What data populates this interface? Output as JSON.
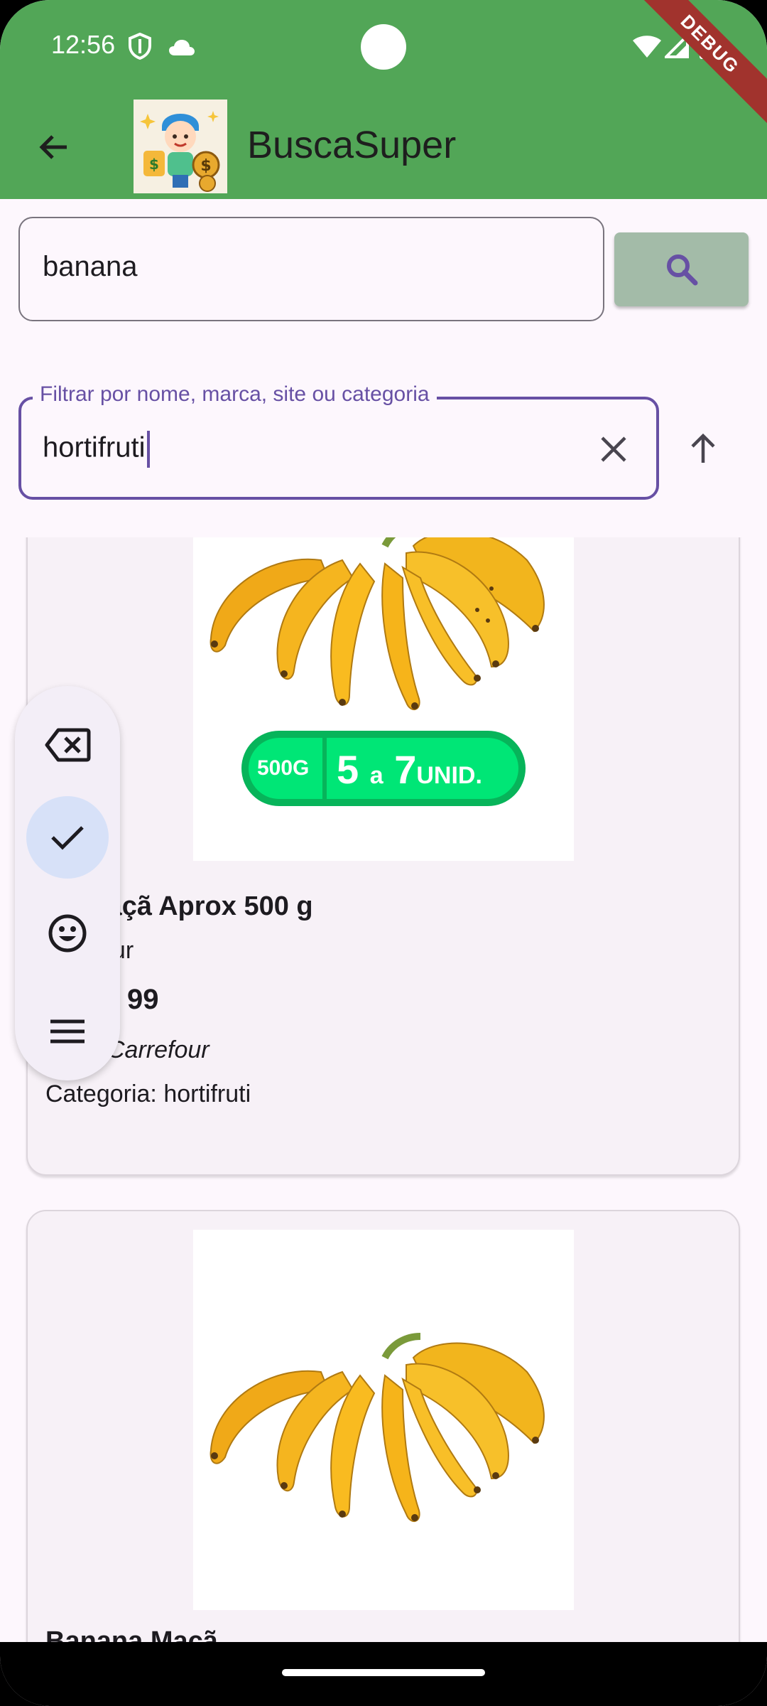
{
  "status_bar": {
    "time": "12:56"
  },
  "debug_banner": "DEBUG",
  "app_bar": {
    "title": "BuscaSuper"
  },
  "search": {
    "value": "banana"
  },
  "filter": {
    "label": "Filtrar por nome, marca, site ou categoria",
    "value": "hortifruti"
  },
  "products": [
    {
      "badge_weight": "500G",
      "badge_range_start": "5",
      "badge_range_word": "a",
      "badge_range_end": "7",
      "badge_unit": "UNID.",
      "name": "na Maçã Aprox 500 g",
      "brand": "our",
      "price": "99",
      "site": "Carrefour",
      "category": "Categoria: hortifruti"
    },
    {
      "name": "Banana Maçã"
    }
  ],
  "colors": {
    "app_bar": "#52a657",
    "accent": "#6750a4",
    "search_button": "#a3bba8"
  }
}
